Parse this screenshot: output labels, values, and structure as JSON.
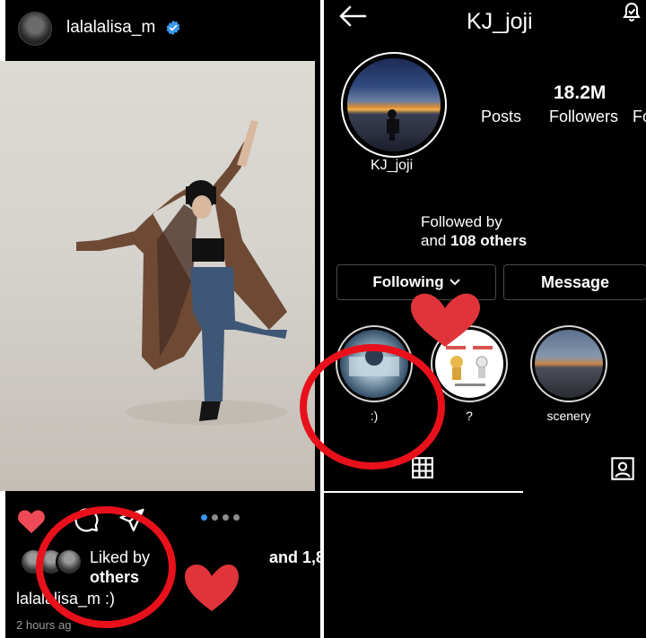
{
  "left_post": {
    "username": "lalalalisa_m",
    "verified": true,
    "liked_by_line1": "Liked by",
    "liked_by_line2": "others",
    "liked_by_extra": "and 1,8",
    "caption": "lalalalisa_m :)",
    "time": "2 hours ag"
  },
  "right_profile": {
    "title": "KJ_joji",
    "display_name": "KJ_joji",
    "posts_label": "Posts",
    "followers_count": "18.2M",
    "followers_label": "Followers",
    "following_label_cut": "Fo",
    "followed_by_line1": "Followed by",
    "followed_by_and": "and",
    "followed_by_count": "108 others",
    "following_button": "Following",
    "message_button": "Message",
    "highlights": [
      {
        "label": ":)"
      },
      {
        "label": "?"
      },
      {
        "label": "scenery"
      }
    ]
  },
  "colors": {
    "background": "#000000",
    "verified_blue": "#3897f0",
    "annotation_red": "#e8111b",
    "heart_red": "#e0343a"
  },
  "icons": [
    "verified-badge-icon",
    "like-heart-icon",
    "comment-icon",
    "share-icon",
    "back-arrow-icon",
    "notify-bell-icon",
    "chevron-down-icon",
    "grid-tab-icon",
    "tagged-tab-icon"
  ]
}
